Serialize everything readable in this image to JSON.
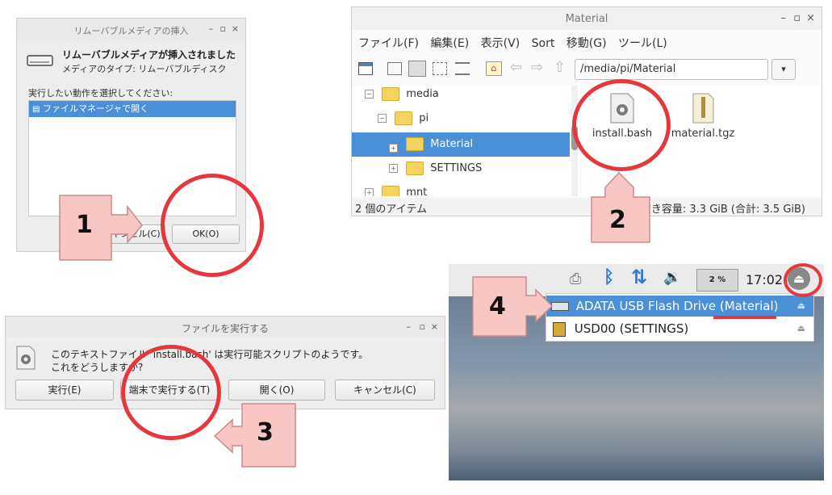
{
  "dialog1": {
    "title": "リムーバブルメディアの挿入",
    "heading": "リムーバブルメディアが挿入されました",
    "media_type": "メディアのタイプ: リムーバブルディスク",
    "prompt": "実行したい動作を選択してください:",
    "option": "ファイルマネージャで開く",
    "cancel_label": "キャンセル(C)",
    "ok_label": "OK(O)",
    "min": "–",
    "max": "▫",
    "close": "×"
  },
  "filemanager": {
    "title": "Material",
    "menu": [
      {
        "label": "ファイル(F)"
      },
      {
        "label": "編集(E)"
      },
      {
        "label": "表示(V)"
      },
      {
        "label": "Sort"
      },
      {
        "label": "移動(G)"
      },
      {
        "label": "ツール(L)"
      }
    ],
    "path": "/media/pi/Material",
    "tree": [
      {
        "label": "media"
      },
      {
        "label": "pi"
      },
      {
        "label": "Material"
      },
      {
        "label": "SETTINGS"
      },
      {
        "label": "mnt"
      }
    ],
    "files": [
      {
        "label": "install.bash",
        "icon": "gear-file-icon"
      },
      {
        "label": "material.tgz",
        "icon": "archive-icon"
      }
    ],
    "status_left": "2 個のアイテム",
    "status_right": "空き容量: 3.3 GiB (合計: 3.5 GiB)",
    "min": "–",
    "max": "▫",
    "close": "×"
  },
  "dialog3": {
    "title": "ファイルを実行する",
    "message": "このテキストファイル 'install.bash' は実行可能スクリプトのようです。",
    "question": "これをどうしますか?",
    "buttons": [
      {
        "label": "実行(E)"
      },
      {
        "label": "端末で実行する(T)"
      },
      {
        "label": "開く(O)"
      },
      {
        "label": "キャンセル(C)"
      }
    ],
    "min": "–",
    "max": "▫",
    "close": "×"
  },
  "taskbar": {
    "cpu": "2 %",
    "clock": "17:02",
    "drives": [
      {
        "label": "ADATA USB Flash Drive (Material)"
      },
      {
        "label": "USD00 (SETTINGS)"
      }
    ]
  },
  "steps": [
    "1",
    "2",
    "3",
    "4"
  ],
  "colors": {
    "highlight": "#4a90d9",
    "circle": "#e5383b",
    "arrow_fill": "#f9c6c6",
    "arrow_stroke": "#c98b8b"
  }
}
